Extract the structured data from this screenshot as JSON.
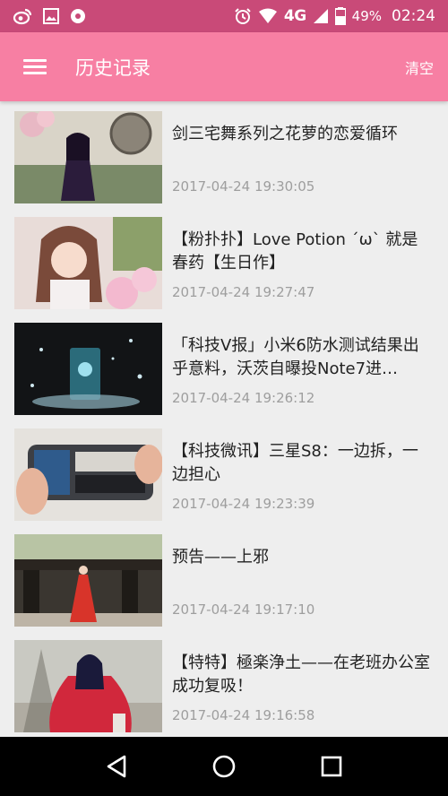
{
  "status_bar": {
    "network": "4G",
    "battery": "49%",
    "time": "02:24"
  },
  "app_bar": {
    "title": "历史记录",
    "clear_label": "清空"
  },
  "history": [
    {
      "title": "剑三宅舞系列之花萝的恋爱循环",
      "time": "2017-04-24 19:30:05"
    },
    {
      "title": "【粉扑扑】Love Potion ´ω` 就是春药【生日作】",
      "time": "2017-04-24 19:27:47"
    },
    {
      "title": "「科技V报」小米6防水测试结果出乎意料，沃茨自曝投Note7进…",
      "time": "2017-04-24 19:26:12"
    },
    {
      "title": "【科技微讯】三星S8：一边拆，一边担心",
      "time": "2017-04-24 19:23:39"
    },
    {
      "title": "预告——上邪",
      "time": "2017-04-24 19:17:10"
    },
    {
      "title": "【特特】極楽浄土——在老班办公室成功复吸！",
      "time": "2017-04-24 19:16:58"
    }
  ],
  "colors": {
    "status_bar": "#c94a78",
    "app_bar": "#f77fa3",
    "background": "#eeeeee"
  }
}
